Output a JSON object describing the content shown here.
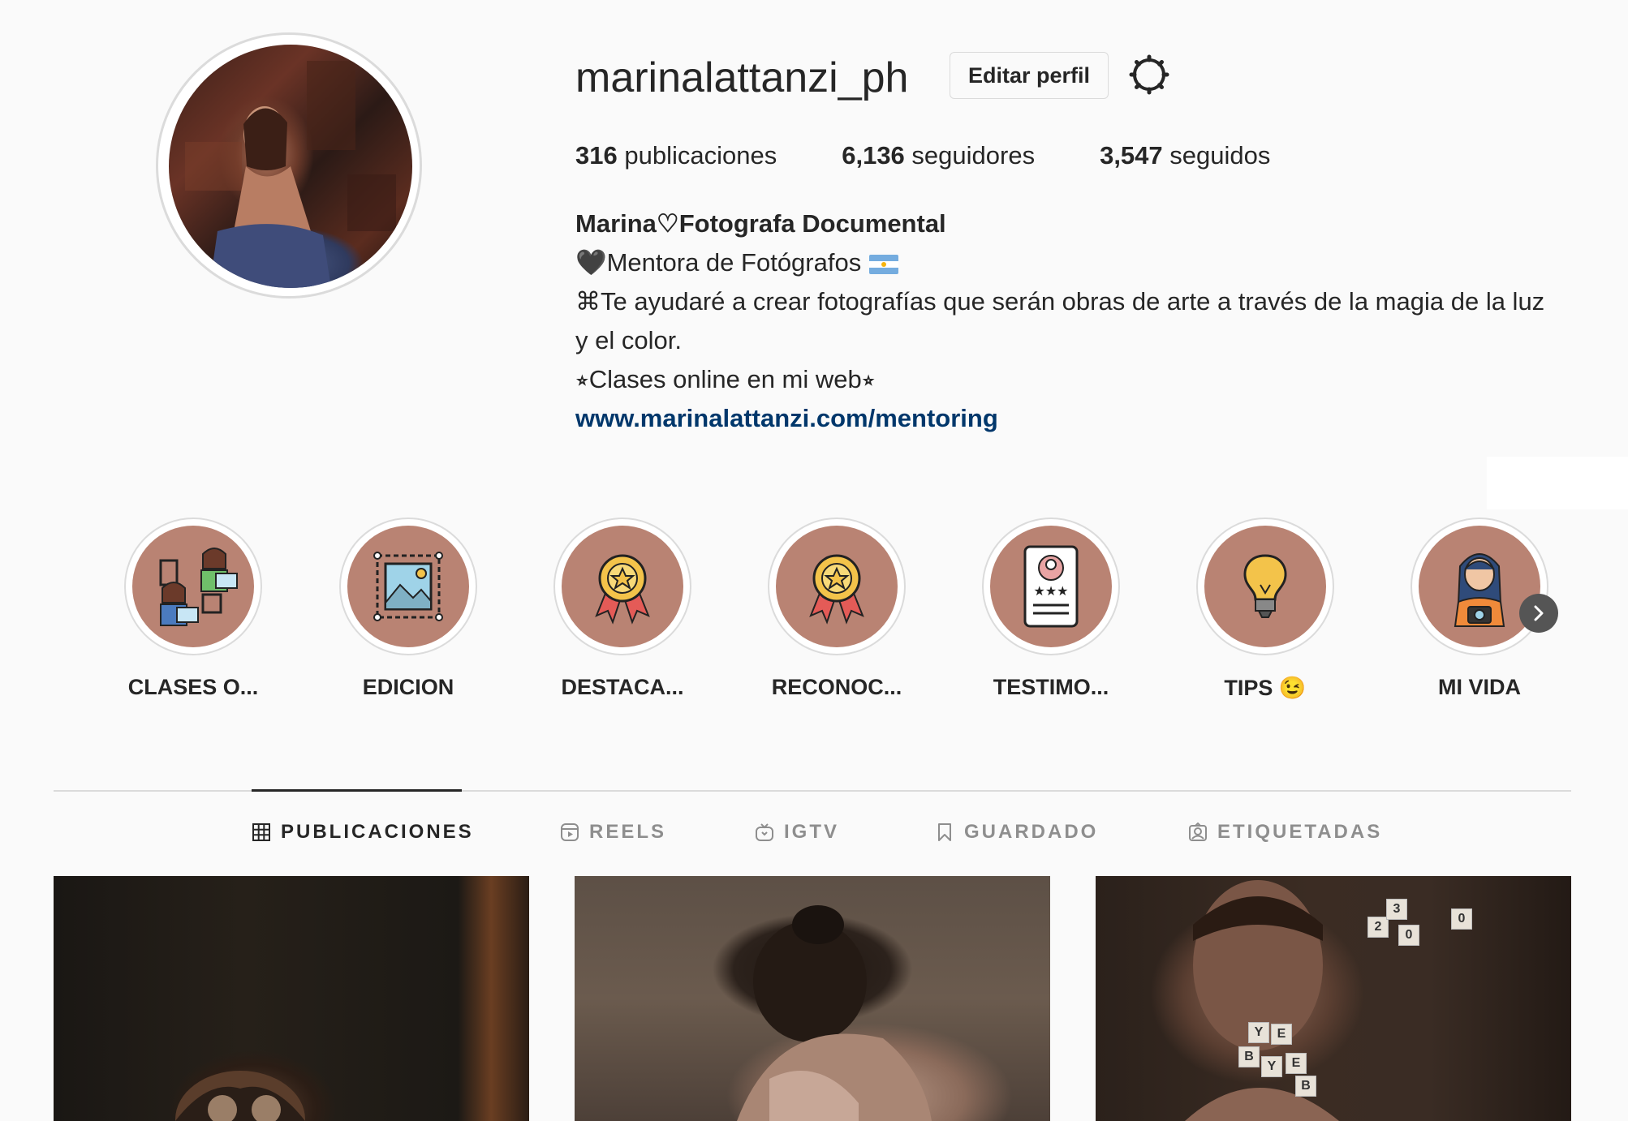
{
  "profile": {
    "username": "marinalattanzi_ph",
    "edit_label": "Editar perfil",
    "stats": {
      "posts_count": "316",
      "posts_label": "publicaciones",
      "followers_count": "6,136",
      "followers_label": "seguidores",
      "following_count": "3,547",
      "following_label": "seguidos"
    },
    "bio": {
      "name": "Marina♡Fotografa Documental",
      "line1": "🖤Mentora de Fotógrafos",
      "line2": "⌘Te ayudaré a crear fotografías que serán obras de arte a través de la magia de la luz y el color.",
      "line3": "⭒Clases online en mi web⭒",
      "link": "www.marinalattanzi.com/mentoring"
    }
  },
  "highlights": [
    {
      "label": "CLASES O...",
      "icon": "online-classes-icon"
    },
    {
      "label": "EDICION",
      "icon": "image-edit-icon"
    },
    {
      "label": "DESTACA...",
      "icon": "award-medal-icon"
    },
    {
      "label": "RECONOC...",
      "icon": "award-medal-icon"
    },
    {
      "label": "TESTIMO...",
      "icon": "testimonial-card-icon"
    },
    {
      "label": "TIPS 😉",
      "icon": "lightbulb-icon"
    },
    {
      "label": "MI VIDA",
      "icon": "photographer-icon"
    }
  ],
  "tabs": [
    {
      "label": "PUBLICACIONES",
      "icon": "grid-icon",
      "active": true
    },
    {
      "label": "REELS",
      "icon": "reels-icon",
      "active": false
    },
    {
      "label": "IGTV",
      "icon": "igtv-icon",
      "active": false
    },
    {
      "label": "GUARDADO",
      "icon": "bookmark-icon",
      "active": false
    },
    {
      "label": "ETIQUETADAS",
      "icon": "tagged-icon",
      "active": false
    }
  ],
  "post_tiles": [
    "2",
    "0",
    "3",
    "0",
    "Y",
    "E",
    "B",
    "Y",
    "E",
    "B"
  ],
  "colors": {
    "background": "#fafafa",
    "text": "#262626",
    "muted": "#8e8e8e",
    "link": "#00376b",
    "highlight_fill": "#b98373"
  }
}
